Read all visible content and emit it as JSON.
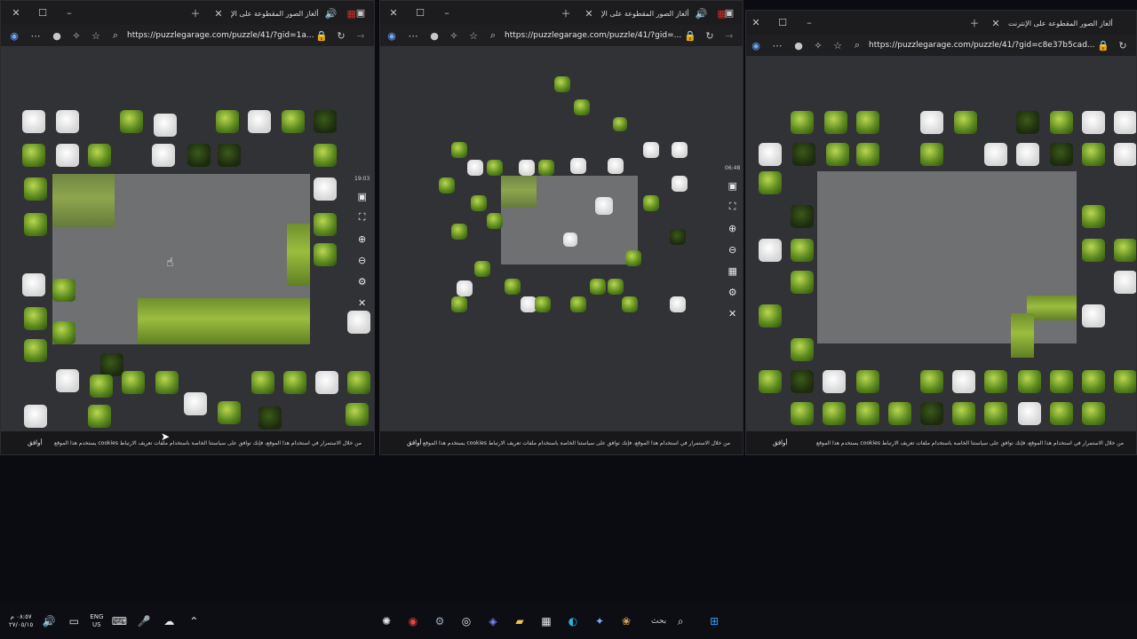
{
  "windows": [
    {
      "tab_title": "ألغاز الصور المقطوعة على الإ",
      "url": "https://puzzlegarage.com/puzzle/41/?gid=1a...",
      "timer": "19:03",
      "cookie_text": "يستخدم هذا الموقع cookies من خلال الاستمرار في استخدام هذا الموقع، فإنك توافق على سياستنا الخاصة باستخدام ملفات تعريف الارتباط",
      "cookie_ok": "أوافق"
    },
    {
      "tab_title": "ألغاز الصور المقطوعة على الإ",
      "url": "https://puzzlegarage.com/puzzle/41/?gid=...",
      "timer": "06:48",
      "cookie_text": "يستخدم هذا الموقع cookies من خلال الاستمرار في استخدام هذا الموقع، فإنك توافق على سياستنا الخاصة باستخدام ملفات تعريف الارتباط",
      "cookie_ok": "أوافق"
    },
    {
      "tab_title": "ألغاز الصور المقطوعة على الإنترنت",
      "url": "https://puzzlegarage.com/puzzle/41/?gid=c8e37b5cad...",
      "timer": "",
      "cookie_text": "يستخدم هذا الموقع cookies من خلال الاستمرار في استخدام هذا الموقع، فإنك توافق على سياستنا الخاصة باستخدام ملفات تعريف الارتباط",
      "cookie_ok": "أوافق"
    }
  ],
  "taskbar": {
    "clock_time": "٠٨:٥٧ م",
    "clock_date": "٢٧/٠٥/١٥",
    "lang_top": "ENG",
    "lang_bottom": "US",
    "search_label": "بحث"
  },
  "colors": {
    "desktop": "#0b0b12",
    "window": "#1f1f22",
    "puzzle_bg": "#313236",
    "board": "#6f7072",
    "grass": "#9bbd3d"
  }
}
